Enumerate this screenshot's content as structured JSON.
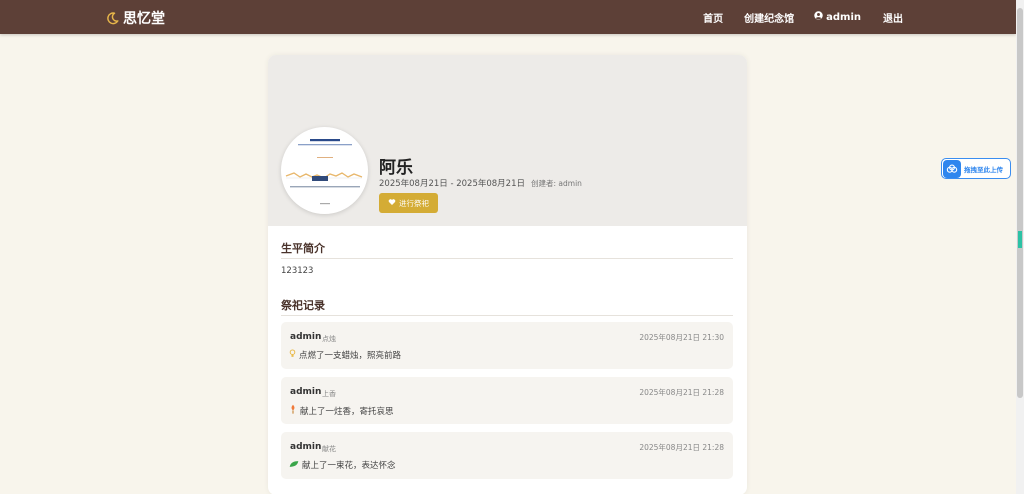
{
  "nav": {
    "brand": "思忆堂",
    "home": "首页",
    "create": "创建纪念馆",
    "user": "admin",
    "logout": "退出"
  },
  "profile": {
    "name": "阿乐",
    "dates": "2025年08月21日 - 2025年08月21日",
    "creator": "创建者: admin",
    "tribute_button": "进行祭祀"
  },
  "bio": {
    "title": "生平简介",
    "text": "123123"
  },
  "records": {
    "title": "祭祀记录",
    "items": [
      {
        "user": "admin",
        "type": "点烛",
        "time": "2025年08月21日 21:30",
        "icon": "lightbulb-icon",
        "message": "点燃了一支蜡烛，照亮前路"
      },
      {
        "user": "admin",
        "type": "上香",
        "time": "2025年08月21日 21:28",
        "icon": "incense-icon",
        "message": "献上了一炷香，寄托哀思"
      },
      {
        "user": "admin",
        "type": "献花",
        "time": "2025年08月21日 21:28",
        "icon": "leaf-icon",
        "message": "献上了一束花，表达怀念"
      }
    ]
  },
  "upload_widget": {
    "label": "拖拽至此上传"
  },
  "colors": {
    "navbar": "#5d4037",
    "accent_gold": "#d4ac35",
    "page_bg": "#f8f5ec"
  }
}
